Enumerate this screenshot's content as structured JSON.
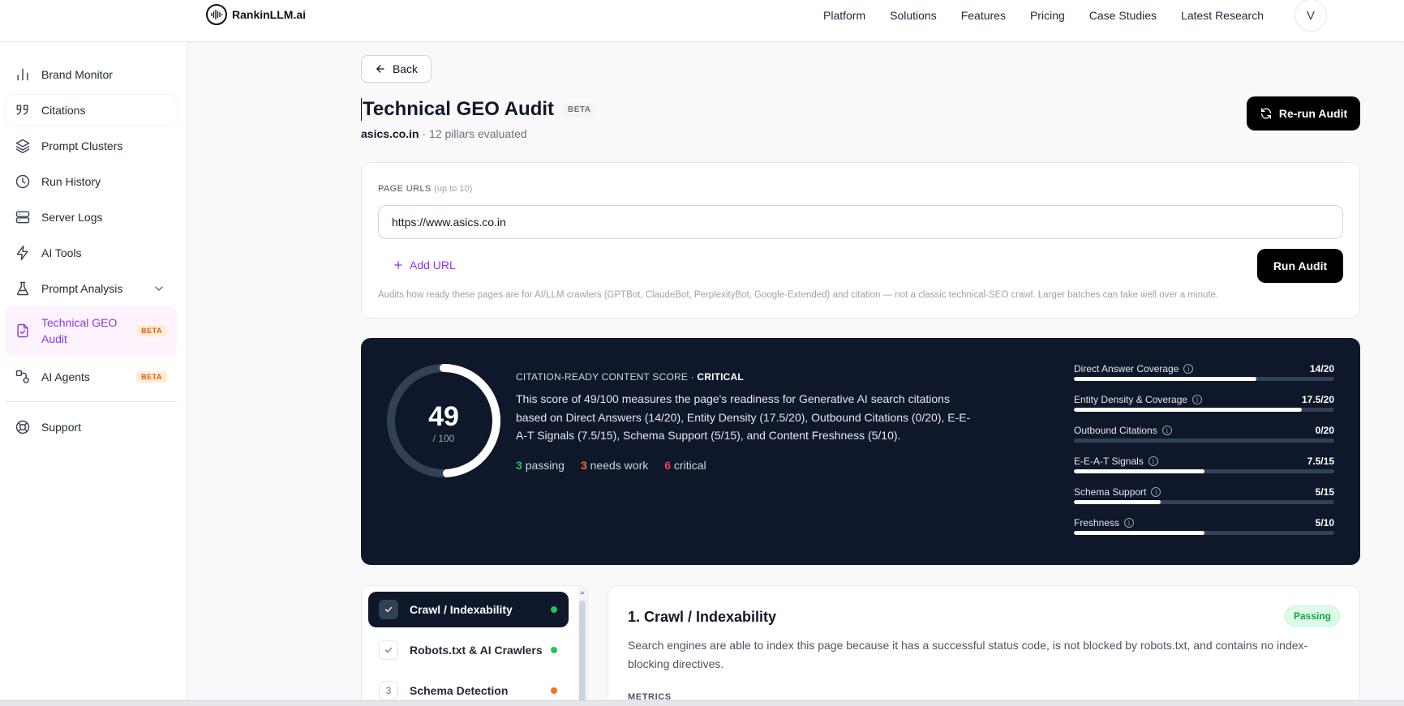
{
  "brand": {
    "name": "RankinLLM.ai"
  },
  "nav": {
    "links": [
      "Platform",
      "Solutions",
      "Features",
      "Pricing",
      "Case Studies",
      "Latest Research"
    ],
    "avatar_initial": "V"
  },
  "sidebar": {
    "items": [
      {
        "label": "Brand Monitor",
        "icon": "bar-chart-icon"
      },
      {
        "label": "Citations",
        "icon": "quote-icon"
      },
      {
        "label": "Prompt Clusters",
        "icon": "layers-icon"
      },
      {
        "label": "Run History",
        "icon": "clock-icon"
      },
      {
        "label": "Server Logs",
        "icon": "server-icon"
      },
      {
        "label": "AI Tools",
        "icon": "bolt-icon"
      },
      {
        "label": "Prompt Analysis",
        "icon": "flask-icon"
      },
      {
        "label": "Technical GEO Audit",
        "icon": "file-check-icon",
        "badge": "BETA"
      },
      {
        "label": "AI Agents",
        "icon": "agents-icon",
        "badge": "BETA"
      }
    ],
    "support_label": "Support"
  },
  "page": {
    "back_label": "Back",
    "title": "Technical GEO Audit",
    "title_badge": "BETA",
    "domain": "asics.co.in",
    "pillars_note": "· 12 pillars evaluated",
    "rerun_label": "Re-run Audit"
  },
  "urls": {
    "label": "PAGE URLS",
    "label_hint": "(up to 10)",
    "value": "https://www.asics.co.in",
    "add_label": "Add URL",
    "run_label": "Run Audit",
    "note": "Audits how ready these pages are for AI/LLM crawlers (GPTBot, ClaudeBot, PerplexityBot, Google-Extended) and citation — not a classic technical-SEO crawl. Larger batches can take well over a minute."
  },
  "score": {
    "value": "49",
    "max": "/ 100",
    "fraction": 0.49,
    "heading": "CITATION-READY CONTENT SCORE ·",
    "severity": "CRITICAL",
    "description": "This score of 49/100 measures the page's readiness for Generative AI search citations based on Direct Answers (14/20), Entity Density (17.5/20), Outbound Citations (0/20), E-E-A-T Signals (7.5/15), Schema Support (5/15), and Content Freshness (5/10).",
    "passing_count": "3",
    "passing_label": "passing",
    "needs_work_count": "3",
    "needs_work_label": "needs work",
    "critical_count": "6",
    "critical_label": "critical",
    "colors": {
      "passing": "#22c55e",
      "needs_work": "#f97316",
      "critical": "#ef4444"
    },
    "metrics": [
      {
        "label": "Direct Answer Coverage",
        "value": "14/20",
        "fraction": 0.7
      },
      {
        "label": "Entity Density & Coverage",
        "value": "17.5/20",
        "fraction": 0.875
      },
      {
        "label": "Outbound Citations",
        "value": "0/20",
        "fraction": 0
      },
      {
        "label": "E-E-A-T Signals",
        "value": "7.5/15",
        "fraction": 0.5
      },
      {
        "label": "Schema Support",
        "value": "5/15",
        "fraction": 0.333
      },
      {
        "label": "Freshness",
        "value": "5/10",
        "fraction": 0.5
      }
    ]
  },
  "pillars": [
    {
      "label": "Crawl / Indexability",
      "marker": "check",
      "status_color": "#22c55e"
    },
    {
      "label": "Robots.txt & AI Crawlers",
      "marker": "check",
      "status_color": "#22c55e"
    },
    {
      "label": "Schema Detection",
      "marker": "3",
      "status_color": "#f97316"
    }
  ],
  "detail": {
    "title": "1. Crawl / Indexability",
    "status": "Passing",
    "text": "Search engines are able to index this page because it has a successful status code, is not blocked by robots.txt, and contains no index-blocking directives.",
    "section_label": "METRICS"
  }
}
